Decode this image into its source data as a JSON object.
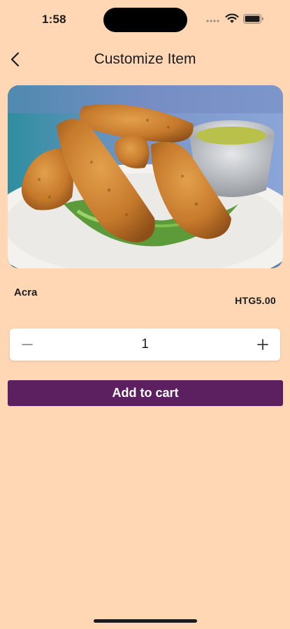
{
  "status_bar": {
    "time": "1:58",
    "icons": [
      "signal-dots-icon",
      "wifi-icon",
      "battery-icon"
    ]
  },
  "nav": {
    "title": "Customize Item",
    "back_icon": "chevron-left-icon"
  },
  "item": {
    "name": "Acra",
    "price": "HTG5.00",
    "image": "fried-acra-fritters-photo"
  },
  "quantity": {
    "value": "1",
    "minus_icon": "minus-icon",
    "plus_icon": "plus-icon"
  },
  "actions": {
    "add_to_cart": "Add to cart"
  },
  "colors": {
    "background": "#FFD7B4",
    "accent": "#5C1F60",
    "card": "#FFFFFF"
  }
}
